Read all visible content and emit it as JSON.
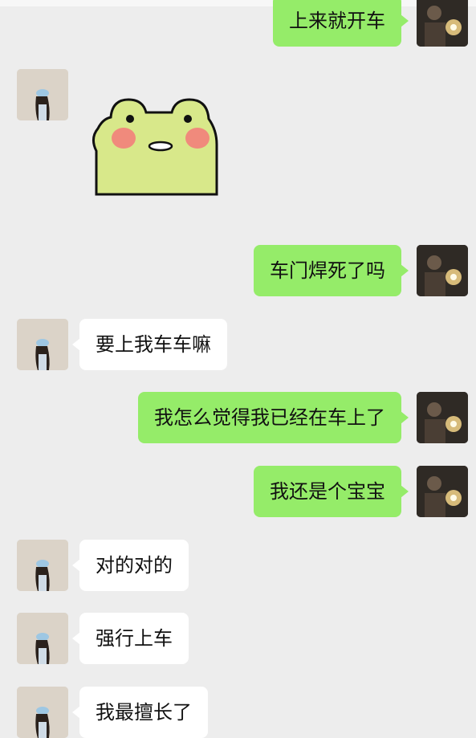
{
  "chat": {
    "messages": [
      {
        "side": "right",
        "text": "上来就开车"
      },
      {
        "side": "left",
        "type": "sticker",
        "sticker": "frog-blush-sticker"
      },
      {
        "side": "right",
        "text": "车门焊死了吗"
      },
      {
        "side": "left",
        "text": "要上我车车嘛"
      },
      {
        "side": "right",
        "text": "我怎么觉得我已经在车上了"
      },
      {
        "side": "right",
        "text": "我还是个宝宝"
      },
      {
        "side": "left",
        "text": "对的对的"
      },
      {
        "side": "left",
        "text": "强行上车"
      },
      {
        "side": "left",
        "text": "我最擅长了"
      }
    ]
  },
  "colors": {
    "background": "#ededed",
    "my_bubble": "#95ec69",
    "their_bubble": "#ffffff"
  }
}
